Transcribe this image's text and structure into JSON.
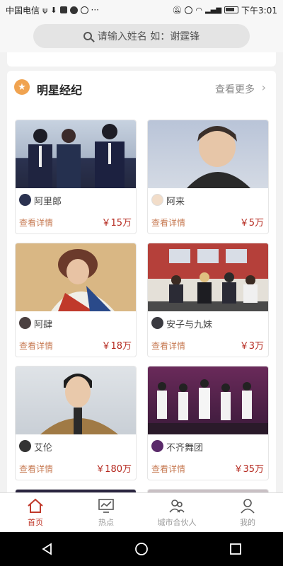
{
  "status_bar": {
    "carrier": "中国电信",
    "time": "下午3:01",
    "left_icons": [
      "usb-icon",
      "download-icon",
      "shield-icon",
      "chat-icon",
      "browser-icon"
    ],
    "right_icons": [
      "mute-icon",
      "eye-icon",
      "wifi-icon",
      "signal-icon",
      "battery-icon"
    ]
  },
  "search": {
    "placeholder": "请输入姓名 如：谢霆锋"
  },
  "section": {
    "title": "明星经纪",
    "more_label": "查看更多",
    "accent_color": "#f0a350"
  },
  "cards": [
    {
      "name": "阿里郎",
      "detail_label": "查看详情",
      "price": "￥15万",
      "photo_colors": [
        "#c7d2e0",
        "#2b3250"
      ]
    },
    {
      "name": "阿来",
      "detail_label": "查看详情",
      "price": "￥5万",
      "photo_colors": [
        "#b9c4d8",
        "#3b3b3b"
      ]
    },
    {
      "name": "阿肆",
      "detail_label": "查看详情",
      "price": "￥18万",
      "photo_colors": [
        "#d9b784",
        "#8a4a3a"
      ]
    },
    {
      "name": "安子与九妹",
      "detail_label": "查看详情",
      "price": "￥3万",
      "photo_colors": [
        "#a33a35",
        "#3a3a40"
      ]
    },
    {
      "name": "艾伦",
      "detail_label": "查看详情",
      "price": "￥180万",
      "photo_colors": [
        "#d6dade",
        "#a07a45"
      ]
    },
    {
      "name": "不齐舞团",
      "detail_label": "查看详情",
      "price": "￥35万",
      "photo_colors": [
        "#6a2a5a",
        "#e8e8ef"
      ]
    }
  ],
  "bottom_nav": [
    {
      "label": "首页",
      "icon": "home-icon",
      "active": true
    },
    {
      "label": "热点",
      "icon": "trend-chart-icon",
      "active": false
    },
    {
      "label": "城市合伙人",
      "icon": "partners-icon",
      "active": false
    },
    {
      "label": "我的",
      "icon": "user-icon",
      "active": false
    }
  ],
  "colors": {
    "price": "#b5281e",
    "detail": "#c77b54",
    "nav_active": "#c0392b"
  }
}
